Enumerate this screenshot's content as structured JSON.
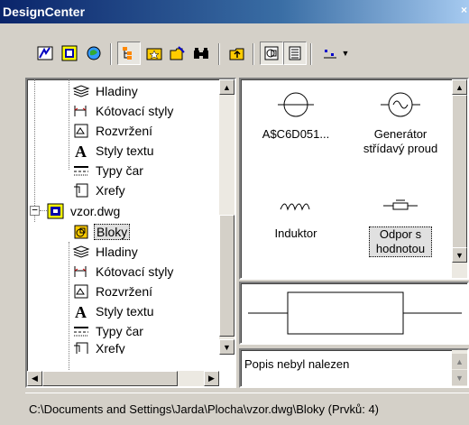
{
  "window": {
    "title": "DesignCenter"
  },
  "toolbar": {
    "buttons": [
      "load-icon",
      "open-drawings-icon",
      "history-icon",
      "tree-toggle-icon",
      "favorites-icon",
      "load-drawing-icon",
      "search-icon",
      "up-icon",
      "preview-icon",
      "description-icon",
      "views-icon",
      "dropdown-arrow-icon"
    ],
    "views_dropdown_arrow": "▼"
  },
  "tree": {
    "items": [
      {
        "label": "Hladiny",
        "icon": "layers-icon"
      },
      {
        "label": "Kótovací styly",
        "icon": "dimstyle-icon"
      },
      {
        "label": "Rozvržení",
        "icon": "layout-icon"
      },
      {
        "label": "Styly textu",
        "icon": "textstyle-icon"
      },
      {
        "label": "Typy čar",
        "icon": "linetype-icon"
      },
      {
        "label": "Xrefy",
        "icon": "xref-icon"
      },
      {
        "label": "vzor.dwg",
        "icon": "drawing-icon",
        "expander": "−"
      },
      {
        "label": "Bloky",
        "icon": "blocks-icon",
        "selected": true
      },
      {
        "label": "Hladiny",
        "icon": "layers-icon"
      },
      {
        "label": "Kótovací styly",
        "icon": "dimstyle-icon"
      },
      {
        "label": "Rozvržení",
        "icon": "layout-icon"
      },
      {
        "label": "Styly textu",
        "icon": "textstyle-icon"
      },
      {
        "label": "Typy čar",
        "icon": "linetype-icon"
      },
      {
        "label": "Xrefy",
        "icon": "xref-icon"
      }
    ]
  },
  "palette": {
    "items": [
      {
        "caption": "A$C6D051...",
        "icon": "lamp-symbol-icon"
      },
      {
        "caption": "Generátor střídavý proud",
        "icon": "ac-generator-symbol-icon"
      },
      {
        "caption": "Induktor",
        "icon": "inductor-symbol-icon"
      },
      {
        "caption": "Odpor s hodnotou",
        "icon": "resistor-value-symbol-icon",
        "selected": true
      }
    ]
  },
  "preview": {
    "icon": "resistor-preview-icon"
  },
  "description": {
    "text": "Popis nebyl nalezen"
  },
  "status": {
    "path": "C:\\Documents and Settings\\Jarda\\Plocha\\vzor.dwg\\Bloky (Prvků: 4)"
  },
  "colors": {
    "titlebar": "#0a246a",
    "face": "#d4d0c8"
  }
}
